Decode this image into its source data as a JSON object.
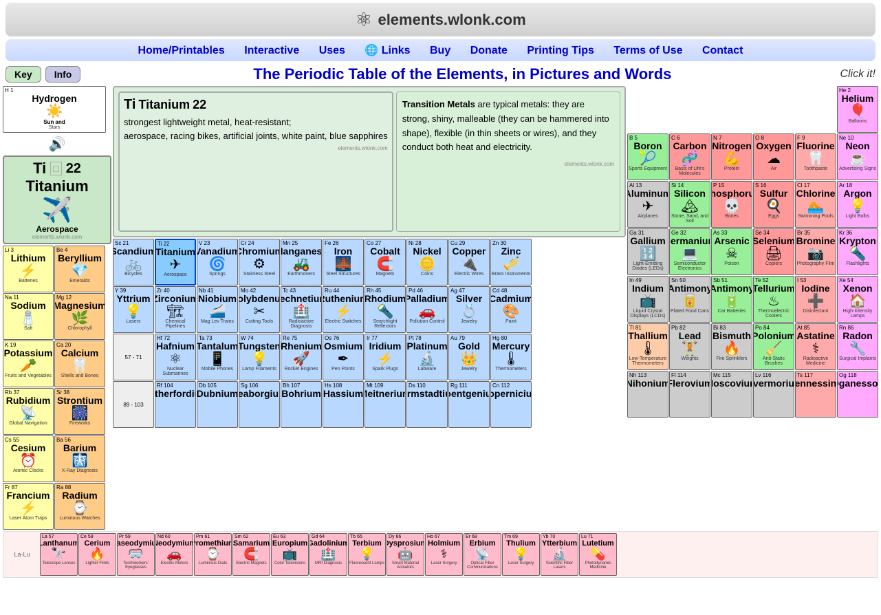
{
  "site": {
    "title": "elements.wlonk.com",
    "page_title": "The Periodic Table of the Elements, in Pictures and Words",
    "click_it": "Click it!"
  },
  "nav": {
    "items": [
      {
        "label": "Home/Printables",
        "href": "#"
      },
      {
        "label": "Interactive",
        "href": "#"
      },
      {
        "label": "Uses",
        "href": "#"
      },
      {
        "label": "Links",
        "href": "#"
      },
      {
        "label": "Buy",
        "href": "#"
      },
      {
        "label": "Donate",
        "href": "#"
      },
      {
        "label": "Printing Tips",
        "href": "#"
      },
      {
        "label": "Terms of Use",
        "href": "#"
      },
      {
        "label": "Contact",
        "href": "#"
      }
    ]
  },
  "buttons": {
    "key": "Key",
    "info": "Info"
  },
  "selected_element": {
    "symbol": "Ti",
    "number": "22",
    "name": "Titanium",
    "uses": "strongest lightweight metal, heat-resistant; aerospace, racing bikes, artificial joints, white paint, blue sapphires",
    "category": "Aerospace",
    "emoji": "✈",
    "watermark": "elements.wlonk.com",
    "description_title": "Transition Metals",
    "description": "are typical metals: they are strong, shiny, malleable (they can be hammered into shape), flexible (in thin sheets or wires), and they conduct both heat and electricity."
  },
  "elements": {
    "row1": [
      {
        "num": "H",
        "n": 1,
        "sym": "H",
        "name": "Hydrogen",
        "use": "Sun and Stars",
        "ico": "☀",
        "color": "c-h"
      },
      {
        "num": "He",
        "n": 2,
        "sym": "He",
        "name": "Helium",
        "use": "Balloons",
        "ico": "🎈",
        "color": "c-nob"
      }
    ]
  }
}
